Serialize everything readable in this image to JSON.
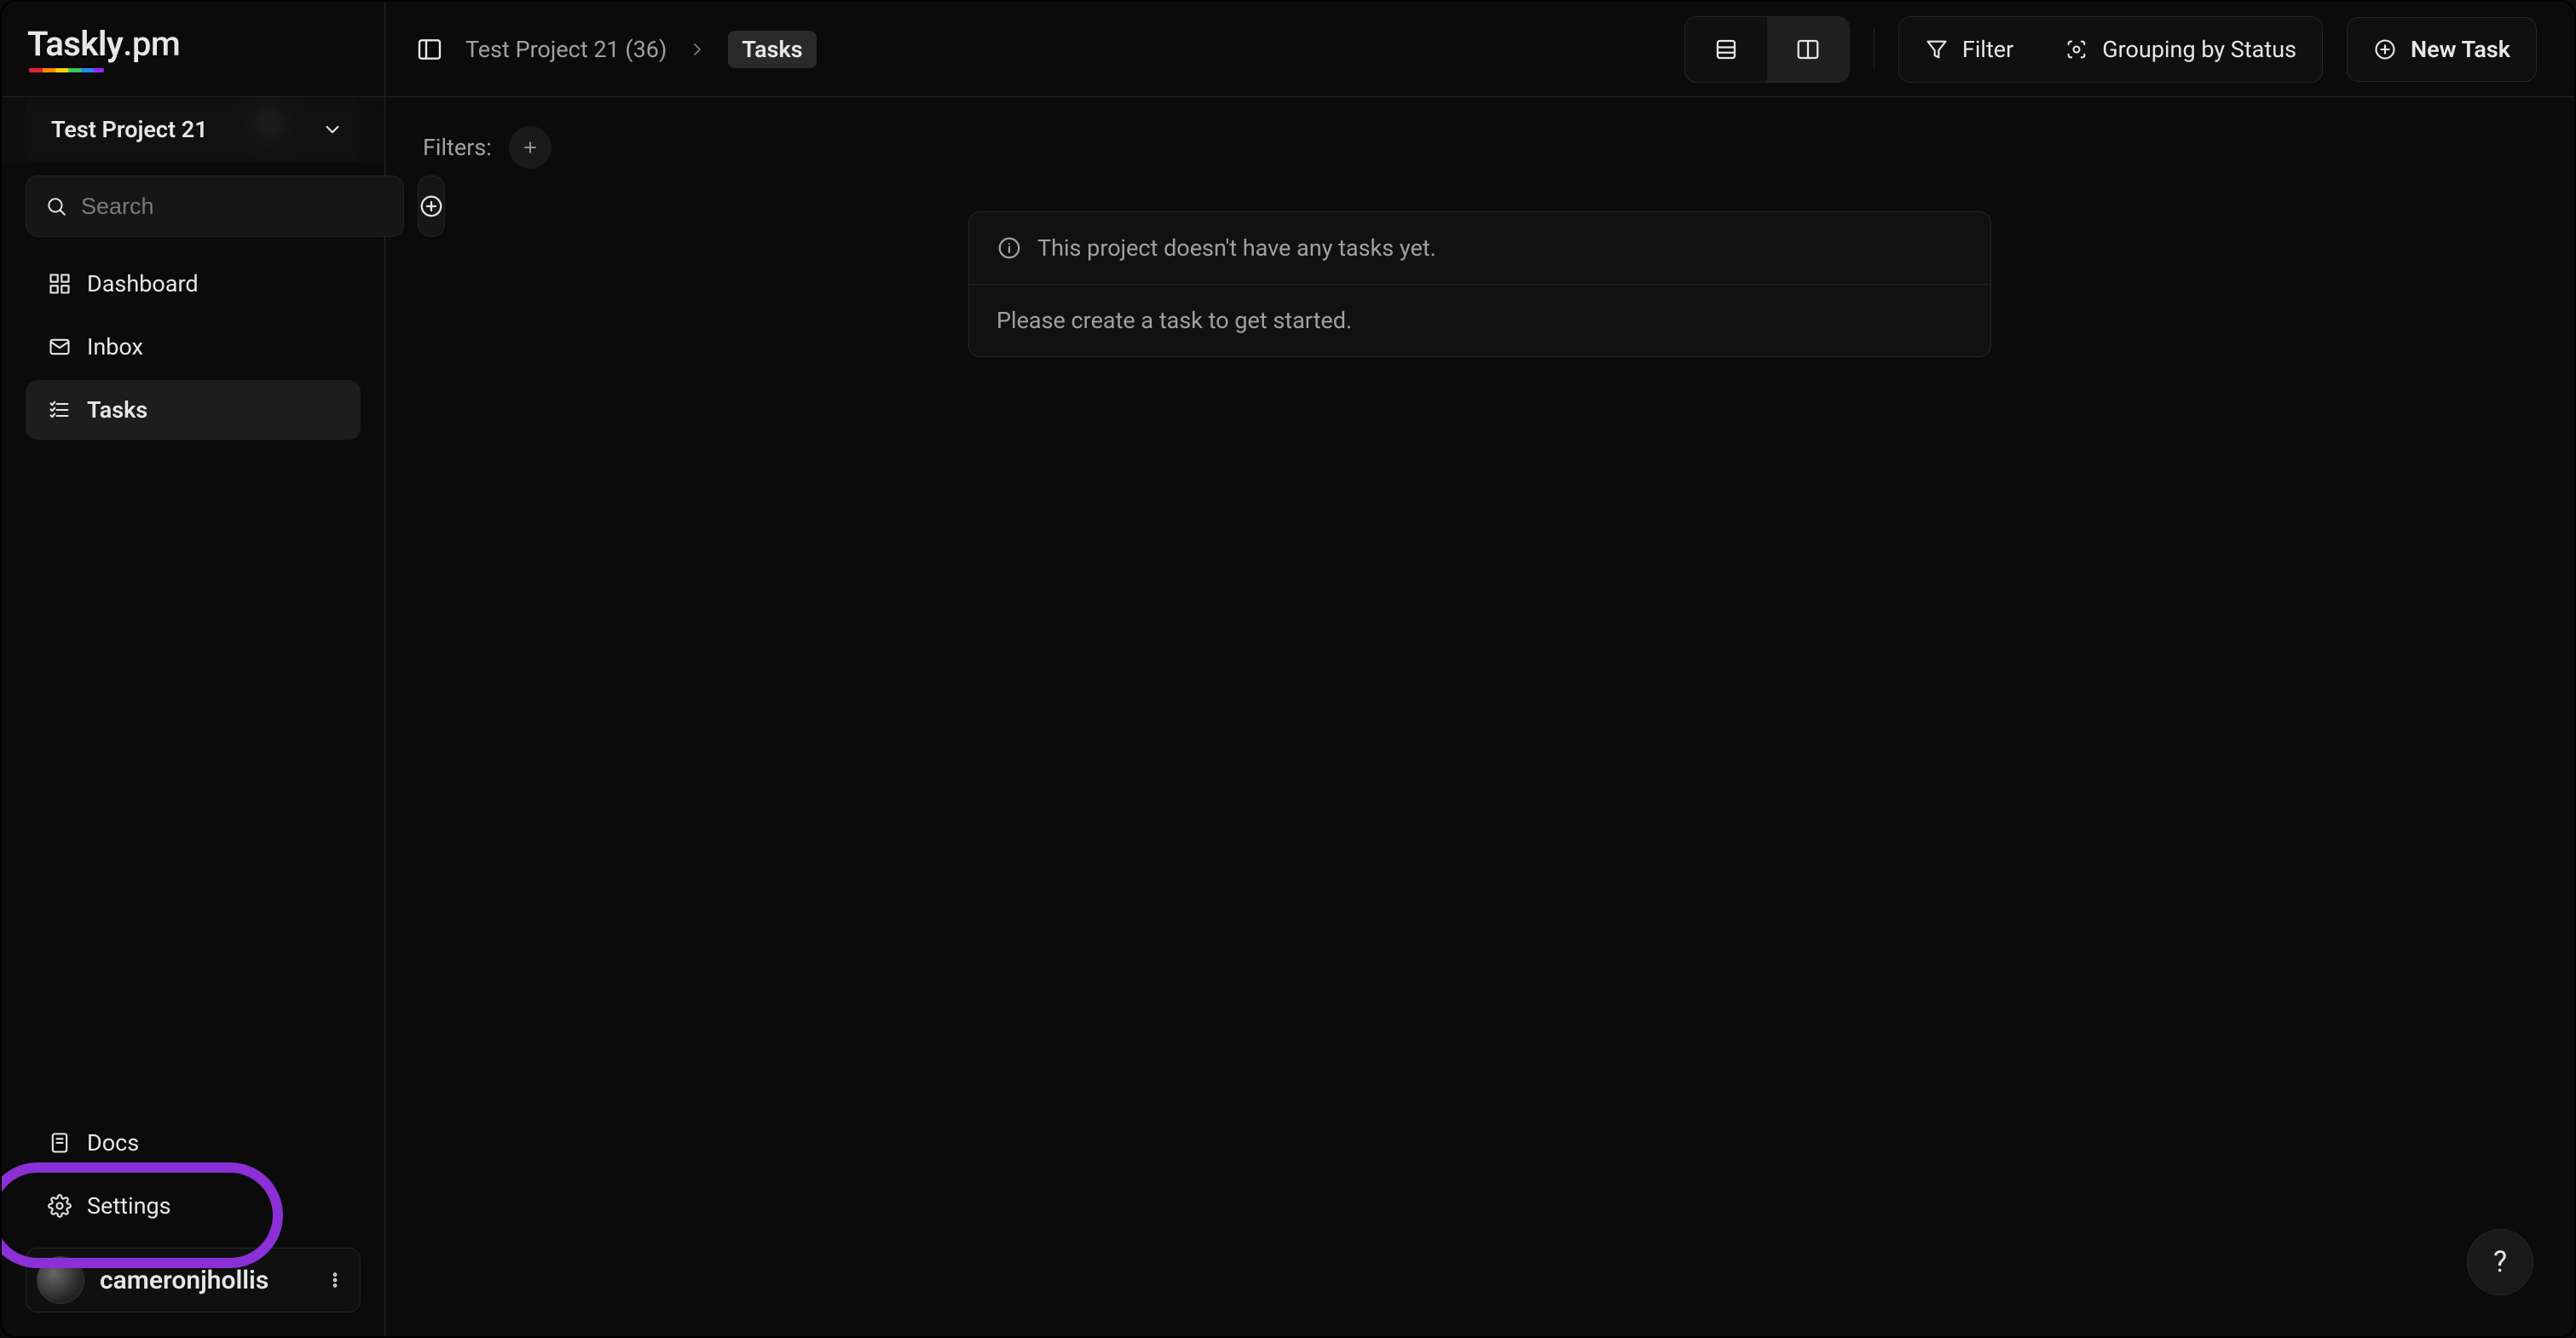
{
  "brand": {
    "name": "Taskly",
    "suffix": ".pm"
  },
  "sidebar": {
    "project_name": "Test Project 21",
    "search_placeholder": "Search",
    "nav": [
      {
        "id": "dashboard",
        "label": "Dashboard",
        "icon": "grid-icon",
        "active": false
      },
      {
        "id": "inbox",
        "label": "Inbox",
        "icon": "mail-icon",
        "active": false
      },
      {
        "id": "tasks",
        "label": "Tasks",
        "icon": "list-check-icon",
        "active": true
      }
    ],
    "bottom": [
      {
        "id": "docs",
        "label": "Docs",
        "icon": "book-icon"
      },
      {
        "id": "settings",
        "label": "Settings",
        "icon": "gear-icon"
      }
    ],
    "user": {
      "name": "cameronjhollis"
    }
  },
  "breadcrumb": {
    "project": "Test Project 21 (36)",
    "current_tag": "Tasks"
  },
  "toolbar": {
    "filter_label": "Filter",
    "grouping_label": "Grouping by Status",
    "new_task_label": "New Task",
    "view_mode": "board"
  },
  "filters": {
    "label": "Filters:"
  },
  "empty": {
    "line1": "This project doesn't have any tasks yet.",
    "line2": "Please create a task to get started."
  },
  "help": {
    "label": "?"
  }
}
